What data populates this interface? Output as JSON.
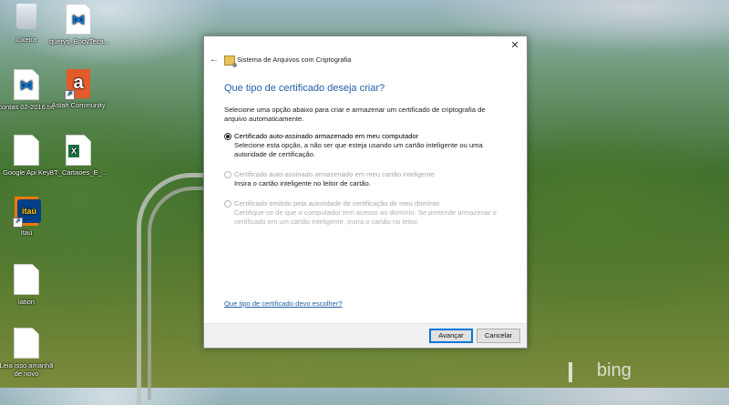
{
  "desktop": {
    "icons": [
      {
        "label": "Lixeira",
        "icon": "recycle-bin-icon"
      },
      {
        "label": "querys_BodyTeca...",
        "icon": "vscode-file-icon"
      },
      {
        "label": "contas 02-2016.txt",
        "icon": "vscode-file-icon"
      },
      {
        "label": "Astah Community",
        "icon": "astah-icon"
      },
      {
        "label": "Google Api Key",
        "icon": "blank-file-icon"
      },
      {
        "label": "BT_Cartaoes_E_...",
        "icon": "excel-file-icon"
      },
      {
        "label": "Itaú",
        "icon": "itau-icon"
      },
      {
        "label": "lation",
        "icon": "blank-file-icon"
      },
      {
        "label": "Leia isso amanhã de novo",
        "icon": "blank-file-icon"
      }
    ],
    "wallpaper_brand": "bing"
  },
  "dialog": {
    "title": "Sistema de Arquivos com Criptografia",
    "heading": "Que tipo de certificado deseja criar?",
    "description": "Selecione uma opção abaixo para criar e armazenar um certificado de criptografia de arquivo automaticamente.",
    "options": [
      {
        "label": "Certificado auto-assinado armazenado em meu computador",
        "detail": "Selecione esta opção, a não ser que esteja usando um cartão inteligente ou uma autoridade de certificação.",
        "selected": true,
        "enabled": true
      },
      {
        "label": "Certificado auto-assinado armazenado em meu cartão inteligente",
        "detail": "Insira o cartão inteligente no leitor de cartão.",
        "selected": false,
        "enabled": false
      },
      {
        "label": "Certificado emitido pela autoridade de certificação de meu domínio",
        "detail": "Certifique-se de que o computador tem acesso ao domínio. Se pretende armazenar o certificado em um cartão inteligente, insira o cartão no leitor.",
        "selected": false,
        "enabled": false
      }
    ],
    "help_link": "Que tipo de certificado devo escolher?",
    "buttons": {
      "next": "Avançar",
      "cancel": "Cancelar"
    },
    "close_glyph": "✕",
    "back_glyph": "←"
  },
  "colors": {
    "heading_blue": "#1f5fa8",
    "primary_border": "#0078d7"
  }
}
